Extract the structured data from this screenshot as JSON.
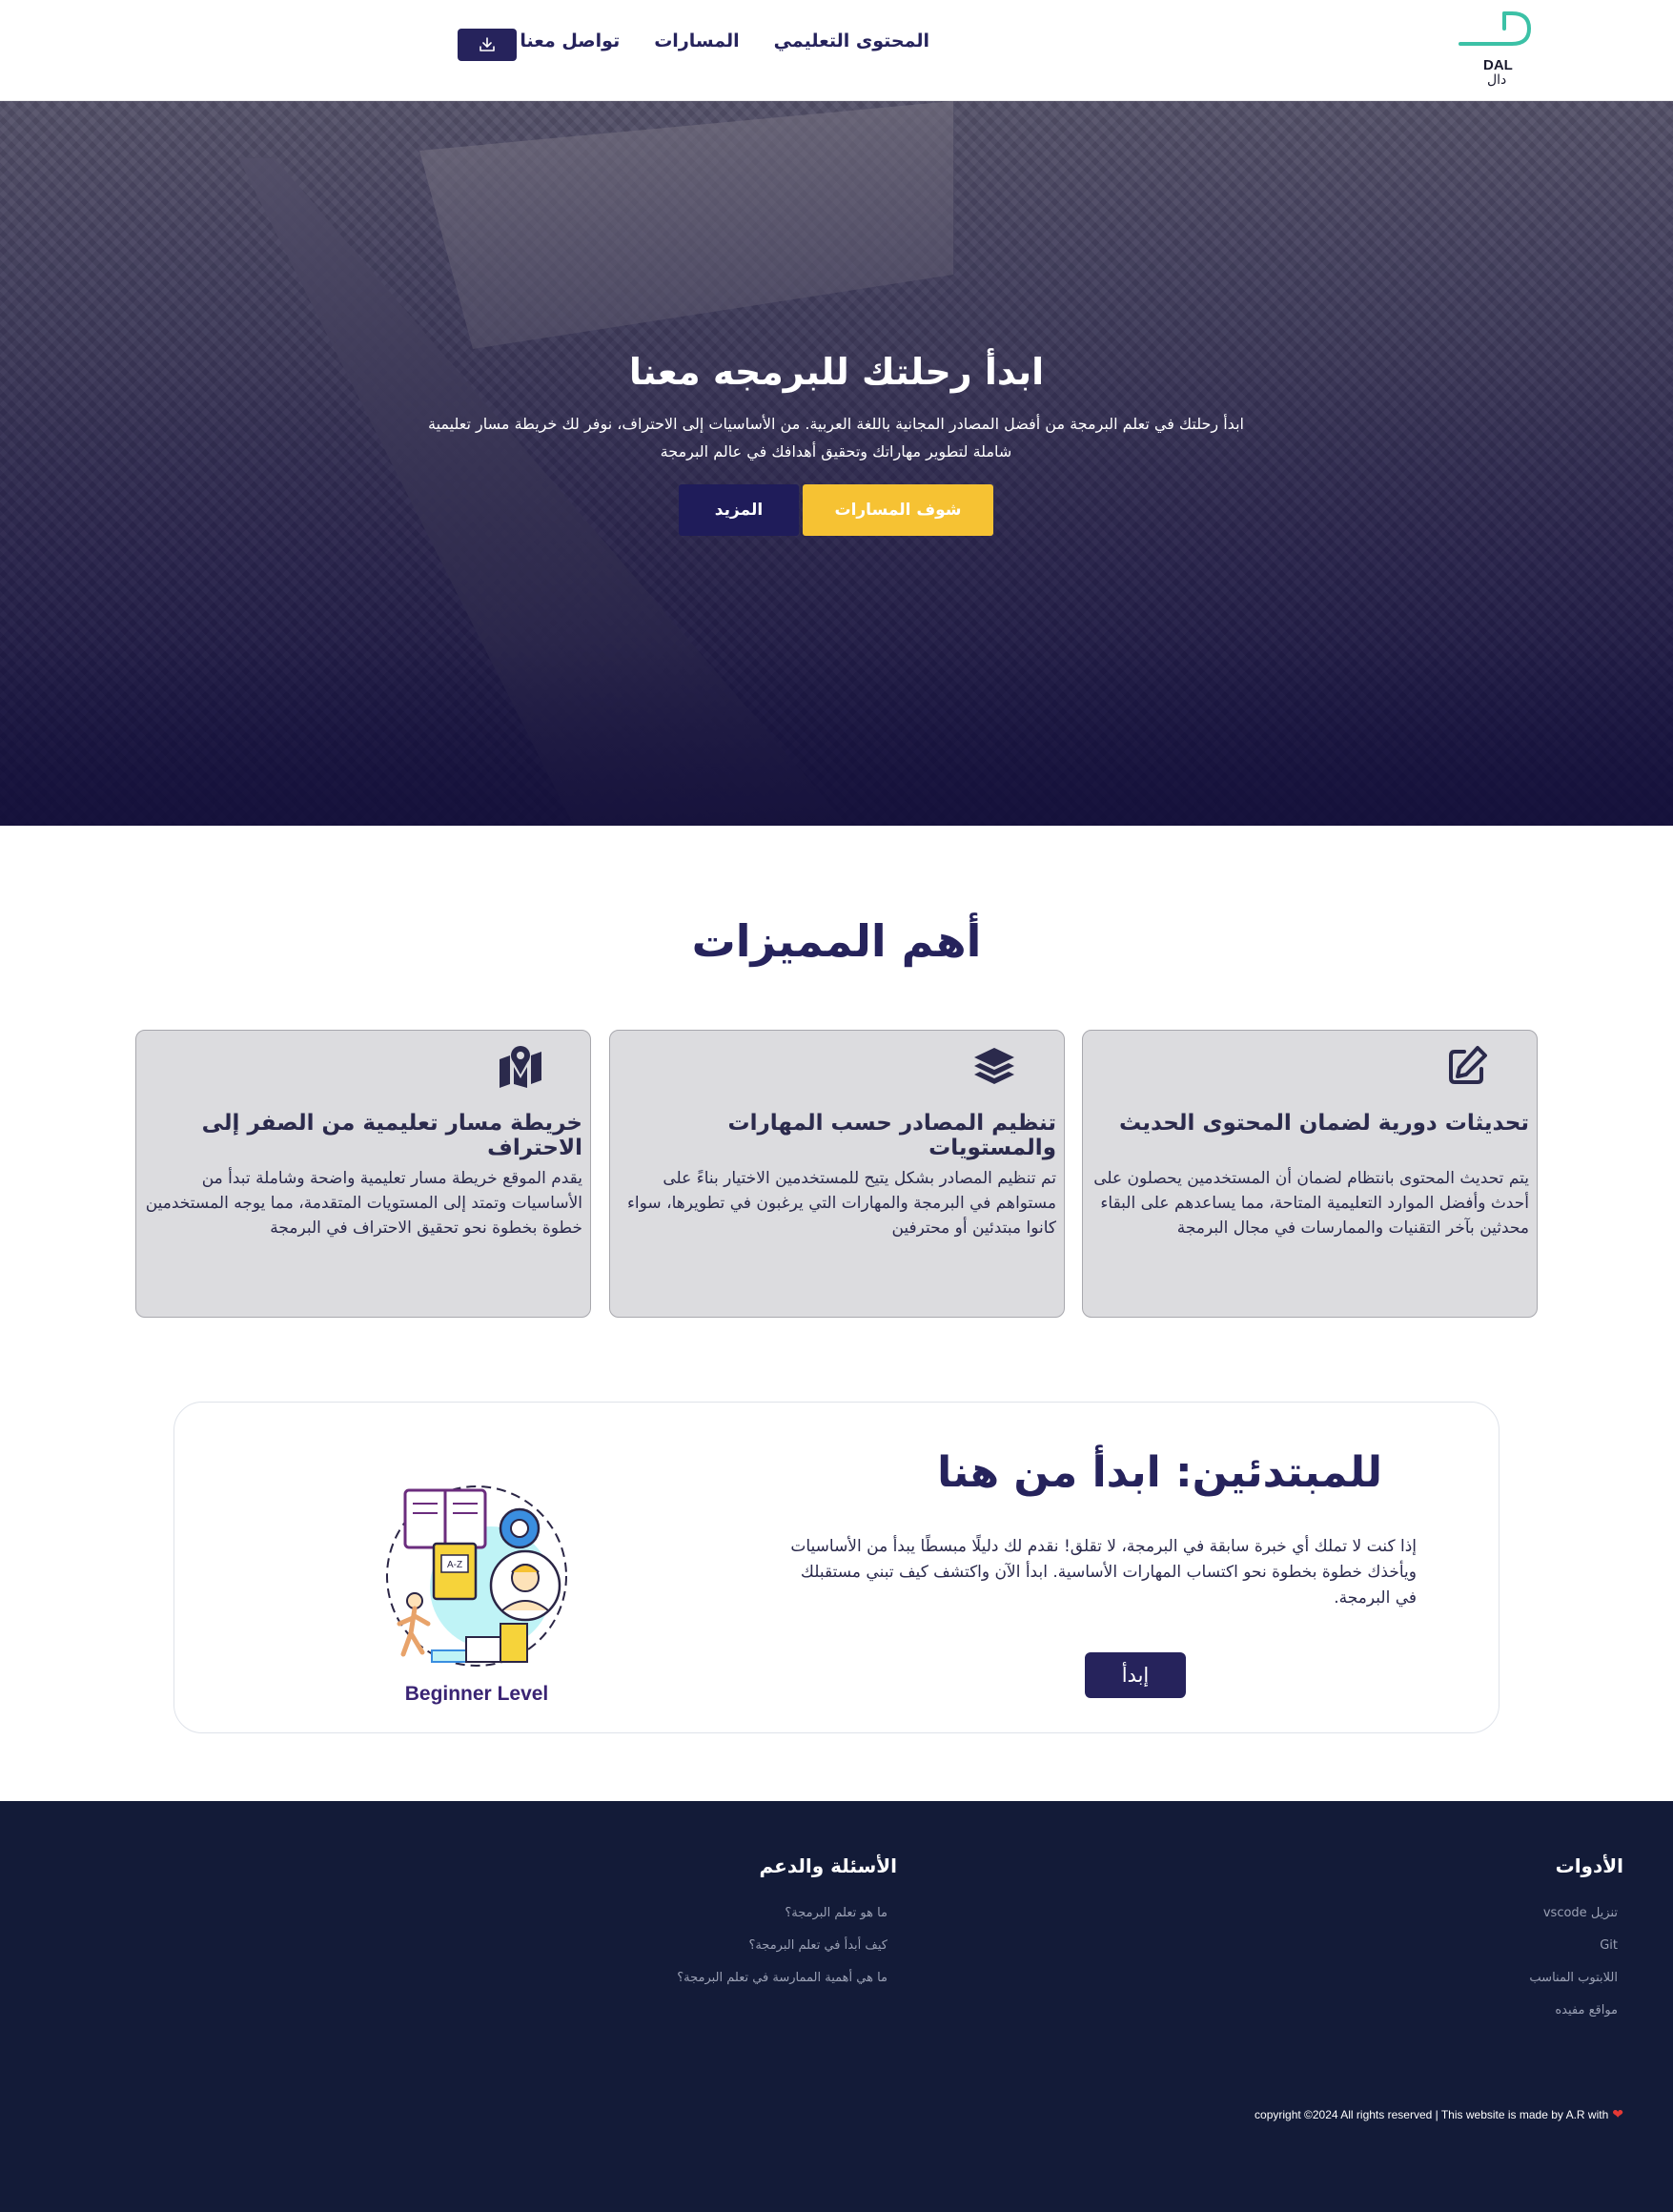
{
  "nav": {
    "logo_en": "DAL",
    "logo_ar": "دال",
    "links": [
      "المحتوى التعليمي",
      "المسارات",
      "تواصل معنا"
    ],
    "download_icon": "download-icon"
  },
  "hero": {
    "title": "ابدأ رحلتك للبرمجه معنا",
    "subtitle": "ابدأ رحلتك في تعلم البرمجة من أفضل المصادر المجانية باللغة العربية. من الأساسيات إلى الاحتراف، نوفر لك خريطة مسار تعليمية شاملة لتطوير مهاراتك وتحقيق أهدافك في عالم البرمجة",
    "btn_more": "المزيد",
    "btn_tracks": "شوف المسارات"
  },
  "features": {
    "title": "أهم المميزات",
    "cards": [
      {
        "icon": "edit-icon",
        "title": "تحديثات دورية لضمان المحتوى الحديث",
        "text": "يتم تحديث المحتوى بانتظام لضمان أن المستخدمين يحصلون على أحدث وأفضل الموارد التعليمية المتاحة، مما يساعدهم على البقاء محدثين بآخر التقنيات والممارسات في مجال البرمجة"
      },
      {
        "icon": "layers-icon",
        "title": "تنظيم المصادر حسب المهارات والمستويات",
        "text": "تم تنظيم المصادر بشكل يتيح للمستخدمين الاختيار بناءً على مستواهم في البرمجة والمهارات التي يرغبون في تطويرها، سواء كانوا مبتدئين أو محترفين"
      },
      {
        "icon": "map-icon",
        "title": "خريطة مسار تعليمية من الصفر إلى الاحتراف",
        "text": "يقدم الموقع خريطة مسار تعليمية واضحة وشاملة تبدأ من الأساسيات وتمتد إلى المستويات المتقدمة، مما يوجه المستخدمين خطوة بخطوة نحو تحقيق الاحتراف في البرمجة"
      }
    ]
  },
  "beginner": {
    "title": "للمبتدئين: ابدأ من هنا",
    "text": "إذا كنت لا تملك أي خبرة سابقة في البرمجة، لا تقلق! نقدم لك دليلًا مبسطًا يبدأ من الأساسيات ويأخذك خطوة بخطوة نحو اكتساب المهارات الأساسية. ابدأ الآن واكتشف كيف تبني مستقبلك في البرمجة.",
    "button": "إبدأ",
    "illustration_label": "Beginner Level"
  },
  "footer": {
    "tools": {
      "heading": "الأدوات",
      "items": [
        "تنزيل vscode",
        "Git",
        "اللابتوب المناسب",
        "مواقع مفيده"
      ]
    },
    "faq": {
      "heading": "الأسئلة والدعم",
      "items": [
        "ما هو تعلم البرمجة؟",
        "كيف أبدأ في تعلم البرمجة؟",
        "ما هي أهمية الممارسة في تعلم البرمجة؟"
      ]
    },
    "copyright": "copyright ©2024 All rights reserved | This website is made by A.R with"
  },
  "colors": {
    "brand_navy": "#26235c",
    "accent_yellow": "#f6c233",
    "logo_teal": "#3cc1a6",
    "footer_bg": "#131b38"
  }
}
